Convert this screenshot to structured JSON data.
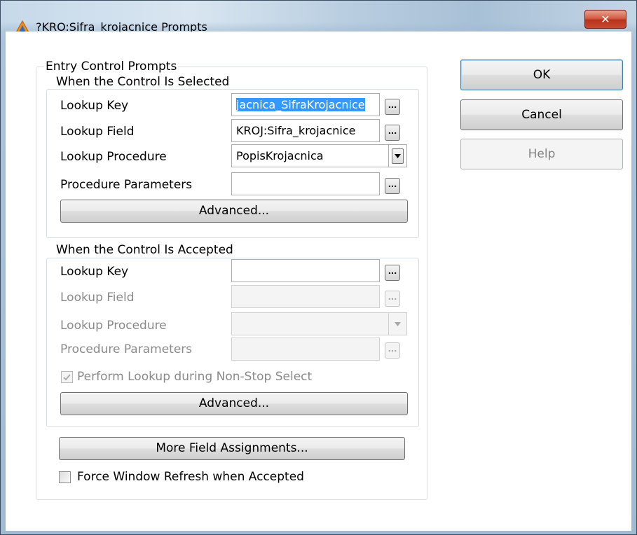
{
  "window": {
    "title": "?KRO:Sifra_krojacnice Prompts",
    "close_glyph": "✕",
    "icon": "warning-triangle-icon"
  },
  "outer_group": {
    "label": "Entry Control Prompts"
  },
  "selected_group": {
    "label": "When the Control Is Selected",
    "lookup_key_label": "Lookup Key",
    "lookup_key_value": "jacnica_SifraKrojacnice",
    "lookup_field_label": "Lookup Field",
    "lookup_field_value": "KROJ:Sifra_krojacnice",
    "lookup_procedure_label": "Lookup Procedure",
    "lookup_procedure_value": "PopisKrojacnica",
    "procedure_parameters_label": "Procedure Parameters",
    "procedure_parameters_value": "",
    "advanced_label": "Advanced..."
  },
  "accepted_group": {
    "label": "When the Control Is Accepted",
    "lookup_key_label": "Lookup Key",
    "lookup_key_value": "",
    "lookup_field_label": "Lookup Field",
    "lookup_field_value": "",
    "lookup_procedure_label": "Lookup Procedure",
    "lookup_procedure_value": "",
    "procedure_parameters_label": "Procedure Parameters",
    "procedure_parameters_value": "",
    "perform_lookup_label": "Perform Lookup during Non-Stop Select",
    "perform_lookup_checked": true,
    "advanced_label": "Advanced..."
  },
  "more_field_assignments_label": "More Field Assignments...",
  "force_refresh_label": "Force Window Refresh when Accepted",
  "force_refresh_checked": false,
  "buttons": {
    "ok": "OK",
    "cancel": "Cancel",
    "help": "Help"
  },
  "ellipsis": "...",
  "colors": {
    "selection": "#3399ff",
    "close_button": "#c94a31",
    "disabled_text": "#8a8a8a"
  }
}
